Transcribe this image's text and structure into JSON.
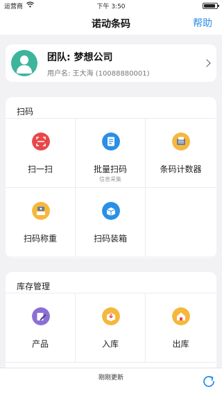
{
  "status_bar": {
    "carrier": "运营商",
    "time": "下午 3:50"
  },
  "nav": {
    "title": "诺动条码",
    "help": "帮助"
  },
  "profile": {
    "team": "团队: 梦想公司",
    "user": "用户名: 王大海 (10088880001)"
  },
  "scan_section": {
    "title": "扫码",
    "items": [
      {
        "label": "扫一扫",
        "icon": "scan-icon",
        "color": "#e8484a"
      },
      {
        "label": "批量扫码",
        "sub": "信息采集",
        "icon": "batch-scan-icon",
        "color": "#2b8fe6"
      },
      {
        "label": "条码计数器",
        "icon": "barcode-counter-icon",
        "color": "#f5b83d"
      },
      {
        "label": "扫码称重",
        "icon": "scale-icon",
        "color": "#f5b83d"
      },
      {
        "label": "扫码装箱",
        "icon": "box-icon",
        "color": "#2b8fe6"
      }
    ]
  },
  "stock_section": {
    "title": "库存管理",
    "items": [
      {
        "label": "产品",
        "icon": "product-icon",
        "color": "#8b6fd6"
      },
      {
        "label": "入库",
        "icon": "inbound-icon",
        "color": "#f5b83d"
      },
      {
        "label": "出库",
        "icon": "outbound-icon",
        "color": "#f5b83d"
      }
    ]
  },
  "bottom": {
    "refresh_text": "刚刚更新"
  }
}
